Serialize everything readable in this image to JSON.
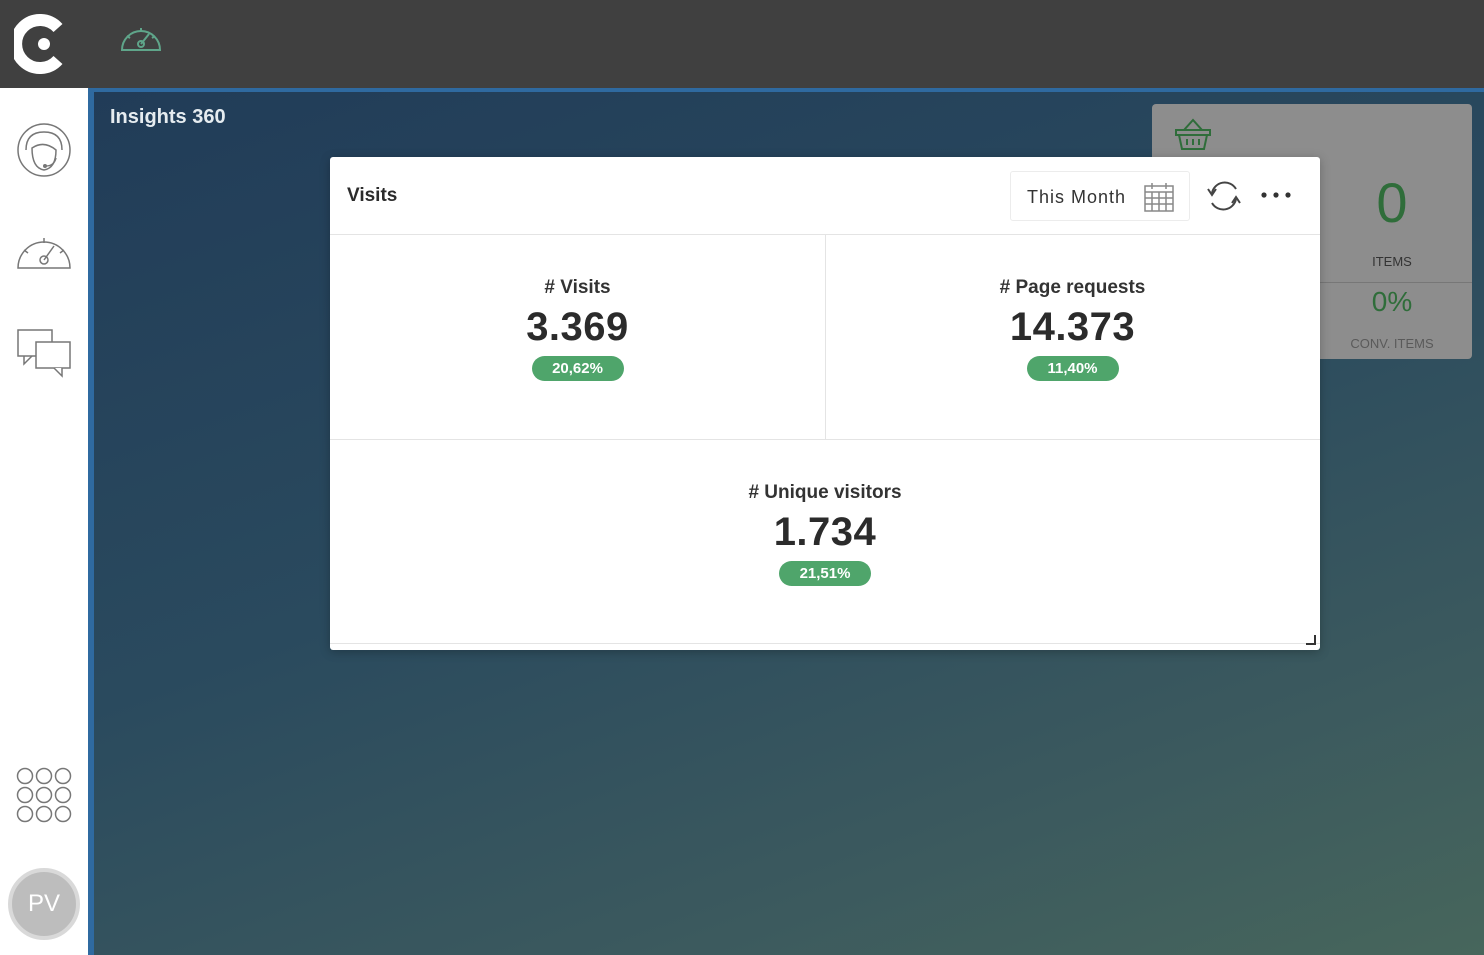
{
  "app": {
    "dashboard_title": "Insights 360"
  },
  "sidebar": {
    "items": [
      {
        "icon": "agent-headset-icon"
      },
      {
        "icon": "speedometer-icon"
      },
      {
        "icon": "chat-bubbles-icon"
      },
      {
        "icon": "apps-grid-icon"
      }
    ],
    "avatar_initials": "PV"
  },
  "background_card": {
    "icon": "basket-icon",
    "items_value": "0",
    "items_label": "ITEMS",
    "conv_value": "0%",
    "conv_label": "CONV. ITEMS"
  },
  "widget": {
    "title": "Visits",
    "period": "This Month",
    "metrics": [
      {
        "label": "# Visits",
        "value": "3.369",
        "change": "20,62%"
      },
      {
        "label": "# Page requests",
        "value": "14.373",
        "change": "11,40%"
      },
      {
        "label": "# Unique visitors",
        "value": "1.734",
        "change": "21,51%"
      }
    ]
  },
  "colors": {
    "topbar": "#404040",
    "accent_green": "#4fa56b",
    "dashboard_bg": "#2a4a5e",
    "accent_blue": "#2f6aa0"
  }
}
